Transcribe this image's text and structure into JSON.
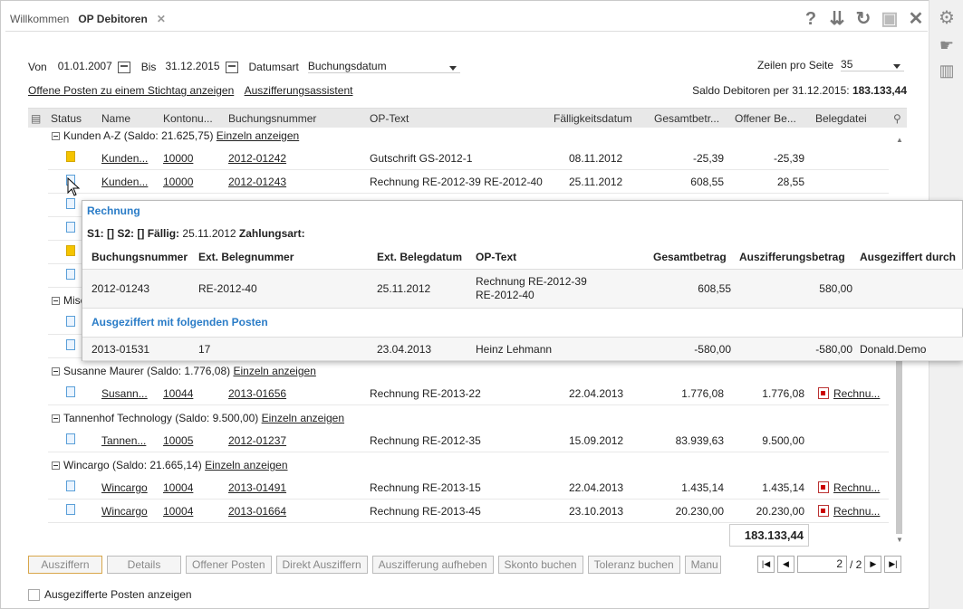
{
  "tabs": [
    {
      "label": "Willkommen"
    },
    {
      "label": "OP Debitoren",
      "close": "✕"
    }
  ],
  "tools": {
    "help": "?",
    "collapse": "⇊",
    "refresh": "↻",
    "save": "▣",
    "close": "✕"
  },
  "filter": {
    "von_label": "Von",
    "von_value": "01.01.2007",
    "bis_label": "Bis",
    "bis_value": "31.12.2015",
    "datumsart_label": "Datumsart",
    "datumsart_value": "Buchungsdatum",
    "zeilen_label": "Zeilen pro Seite",
    "zeilen_value": "35"
  },
  "links": {
    "stichtag": "Offene Posten zu einem Stichtag anzeigen",
    "assistent": "Auszifferungsassistent"
  },
  "saldo": {
    "label": "Saldo Debitoren per 31.12.2015:",
    "value": "183.133,44"
  },
  "columns": [
    "Status",
    "Name",
    "Kontonu...",
    "Buchungsnummer",
    "OP-Text",
    "Fälligkeitsdatum",
    "Gesamtbetr...",
    "Offener Be...",
    "Belegdatei"
  ],
  "groups": [
    {
      "label": "Kunden A-Z (Saldo: 21.625,75)",
      "link": "Einzeln anzeigen"
    },
    {
      "label": "Misc",
      "link": ""
    },
    {
      "label": "Susanne Maurer (Saldo: 1.776,08)",
      "link": "Einzeln anzeigen"
    },
    {
      "label": "Tannenhof Technology (Saldo: 9.500,00)",
      "link": "Einzeln anzeigen"
    },
    {
      "label": "Wincargo (Saldo: 21.665,14)",
      "link": "Einzeln anzeigen"
    }
  ],
  "rows": [
    {
      "name": "Kunden...",
      "konto": "10000",
      "buchung": "2012-01242",
      "optext": "Gutschrift GS-2012-1",
      "faellig": "08.11.2012",
      "gesamt": "-25,39",
      "offen": "-25,39",
      "beleg": ""
    },
    {
      "name": "Kunden...",
      "konto": "10000",
      "buchung": "2012-01243",
      "optext": "Rechnung RE-2012-39 RE-2012-40",
      "faellig": "25.11.2012",
      "gesamt": "608,55",
      "offen": "28,55",
      "beleg": ""
    },
    {
      "name": "Susann...",
      "konto": "10044",
      "buchung": "2013-01656",
      "optext": "Rechnung RE-2013-22",
      "faellig": "22.04.2013",
      "gesamt": "1.776,08",
      "offen": "1.776,08",
      "beleg": "Rechnu..."
    },
    {
      "name": "Tannen...",
      "konto": "10005",
      "buchung": "2012-01237",
      "optext": "Rechnung RE-2012-35",
      "faellig": "15.09.2012",
      "gesamt": "83.939,63",
      "offen": "9.500,00",
      "beleg": ""
    },
    {
      "name": "Wincargo",
      "konto": "10004",
      "buchung": "2013-01491",
      "optext": "Rechnung RE-2013-15",
      "faellig": "22.04.2013",
      "gesamt": "1.435,14",
      "offen": "1.435,14",
      "beleg": "Rechnu..."
    },
    {
      "name": "Wincargo",
      "konto": "10004",
      "buchung": "2013-01664",
      "optext": "Rechnung RE-2013-45",
      "faellig": "23.10.2013",
      "gesamt": "20.230,00",
      "offen": "20.230,00",
      "beleg": "Rechnu..."
    }
  ],
  "total": "183.133,44",
  "buttons": [
    "Ausziffern",
    "Details",
    "Offener Posten",
    "Direkt Ausziffern",
    "Auszifferung aufheben",
    "Skonto buchen",
    "Toleranz buchen",
    "Manu"
  ],
  "pager": {
    "page": "2",
    "of": "/ 2"
  },
  "checkbox_label": "Ausgezifferte Posten anzeigen",
  "popup": {
    "title": "Rechnung",
    "s_line_a": "S1:",
    "s_line_b": "[] S2:",
    "s_line_c": "[] Fällig:",
    "s_line_d": "25.11.2012",
    "s_line_e": "Zahlungsart:",
    "headers": [
      "Buchungsnummer",
      "Ext. Belegnummer",
      "Ext. Belegdatum",
      "OP-Text",
      "Gesamtbetrag",
      "Auszifferungsbetrag",
      "Ausgeziffert durch"
    ],
    "row": {
      "buchung": "2012-01243",
      "ext": "RE-2012-40",
      "datum": "25.11.2012",
      "optext1": "Rechnung RE-2012-39",
      "optext2": "RE-2012-40",
      "gesamt": "608,55",
      "ausz": "580,00"
    },
    "section": "Ausgeziffert mit folgenden Posten",
    "row2": {
      "buchung": "2013-01531",
      "ext": "17",
      "datum": "23.04.2013",
      "optext": "Heinz Lehmann",
      "gesamt": "-580,00",
      "ausz": "-580,00",
      "durch": "Donald.Demo"
    }
  }
}
